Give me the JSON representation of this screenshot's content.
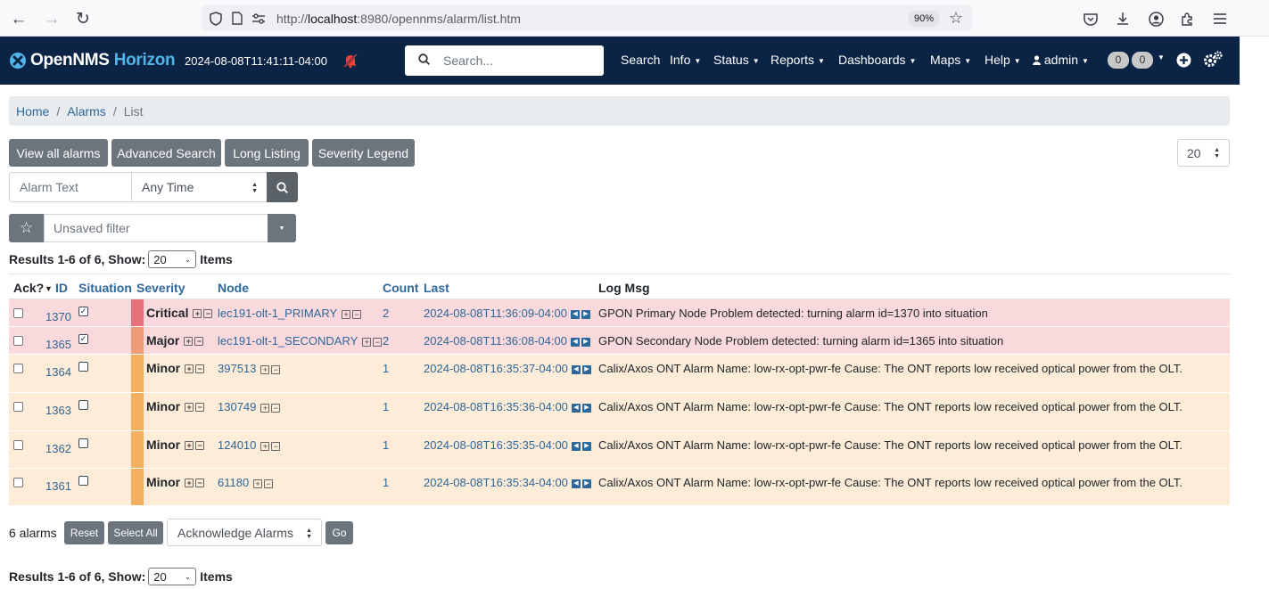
{
  "browser": {
    "url_prefix": "http://",
    "url_host": "localhost",
    "url_rest": ":8980/opennms/alarm/list.htm",
    "zoom": "90%"
  },
  "navbar": {
    "brand_main": "OpenNMS",
    "brand_sub": "Horizon",
    "timestamp": "2024-08-08T11:41:11-04:00",
    "search_placeholder": "Search...",
    "menu": {
      "search": "Search",
      "info": "Info",
      "status": "Status",
      "reports": "Reports",
      "dashboards": "Dashboards",
      "maps": "Maps",
      "help": "Help",
      "user": "admin"
    },
    "badge1": "0",
    "badge2": "0",
    "colors": {
      "background": "#0b2344",
      "accent": "#4fb4e8"
    }
  },
  "breadcrumb": {
    "home": "Home",
    "alarms": "Alarms",
    "current": "List",
    "separator": "/"
  },
  "toolbar": {
    "view_all": "View all alarms",
    "advanced_search": "Advanced Search",
    "long_listing": "Long Listing",
    "severity_legend": "Severity Legend",
    "page_size": "20"
  },
  "search": {
    "alarm_text_placeholder": "Alarm Text",
    "time_value": "Any Time",
    "filter_placeholder": "Unsaved filter"
  },
  "results": {
    "prefix": "Results 1-6 of 6, Show:",
    "show_value": "20",
    "suffix": "Items"
  },
  "table": {
    "headers": {
      "ack": "Ack?",
      "id": "ID",
      "situation": "Situation",
      "severity": "Severity",
      "node": "Node",
      "count": "Count",
      "last": "Last",
      "log_msg": "Log Msg"
    },
    "sort_indicator": "▼",
    "rows": [
      {
        "id": "1370",
        "situation": true,
        "severity": "Critical",
        "node": "lec191-olt-1_PRIMARY",
        "count": "2",
        "last": "2024-08-08T11:36:09-04:00",
        "msg": "GPON Primary Node Problem detected: turning alarm id=1370 into situation"
      },
      {
        "id": "1365",
        "situation": true,
        "severity": "Major",
        "node": "lec191-olt-1_SECONDARY",
        "count": "2",
        "last": "2024-08-08T11:36:08-04:00",
        "msg": "GPON Secondary Node Problem detected: turning alarm id=1365 into situation"
      },
      {
        "id": "1364",
        "situation": false,
        "severity": "Minor",
        "node": "397513",
        "count": "1",
        "last": "2024-08-08T16:35:37-04:00",
        "msg": "Calix/Axos ONT Alarm Name: low-rx-opt-pwr-fe Cause: The ONT reports low received optical power from the OLT."
      },
      {
        "id": "1363",
        "situation": false,
        "severity": "Minor",
        "node": "130749",
        "count": "1",
        "last": "2024-08-08T16:35:36-04:00",
        "msg": "Calix/Axos ONT Alarm Name: low-rx-opt-pwr-fe Cause: The ONT reports low received optical power from the OLT."
      },
      {
        "id": "1362",
        "situation": false,
        "severity": "Minor",
        "node": "124010",
        "count": "1",
        "last": "2024-08-08T16:35:35-04:00",
        "msg": "Calix/Axos ONT Alarm Name: low-rx-opt-pwr-fe Cause: The ONT reports low received optical power from the OLT."
      },
      {
        "id": "1361",
        "situation": false,
        "severity": "Minor",
        "node": "61180",
        "count": "1",
        "last": "2024-08-08T16:35:34-04:00",
        "msg": "Calix/Axos ONT Alarm Name: low-rx-opt-pwr-fe Cause: The ONT reports low received optical power from the OLT."
      }
    ],
    "severity_colors": {
      "Critical": "#e7717d",
      "Major": "#ee9b77",
      "Minor": "#f3b05f"
    }
  },
  "bottom": {
    "alarm_count": "6 alarms",
    "reset": "Reset",
    "select_all": "Select All",
    "action_value": "Acknowledge Alarms",
    "go": "Go"
  }
}
